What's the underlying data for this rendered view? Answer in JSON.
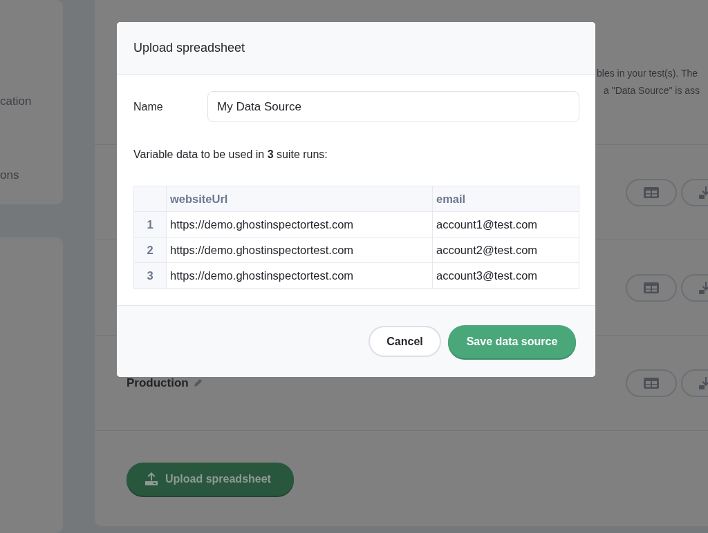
{
  "sidebar": {
    "items": [
      "cation",
      "ons"
    ]
  },
  "main": {
    "intro_lines": [
      "bles in your test(s). The",
      "a \"Data Source\" is ass"
    ],
    "rows": [
      {},
      {},
      {
        "name": "Production"
      }
    ],
    "upload_button": "Upload spreadsheet"
  },
  "dialog": {
    "title": "Upload spreadsheet",
    "name_label": "Name",
    "name_value": "My Data Source",
    "summary": "Variable data to be used in **3** suite runs:",
    "table": {
      "columns": [
        "",
        "websiteUrl",
        "email"
      ],
      "rows": [
        [
          "1",
          "https://demo.ghostinspectortest.com",
          "account1@test.com"
        ],
        [
          "2",
          "https://demo.ghostinspectortest.com",
          "account2@test.com"
        ],
        [
          "3",
          "https://demo.ghostinspectortest.com",
          "account3@test.com"
        ]
      ]
    },
    "buttons": [
      {
        "label": "Cancel",
        "kind": "secondary"
      },
      {
        "label": "Save data source",
        "kind": "primary"
      }
    ]
  }
}
